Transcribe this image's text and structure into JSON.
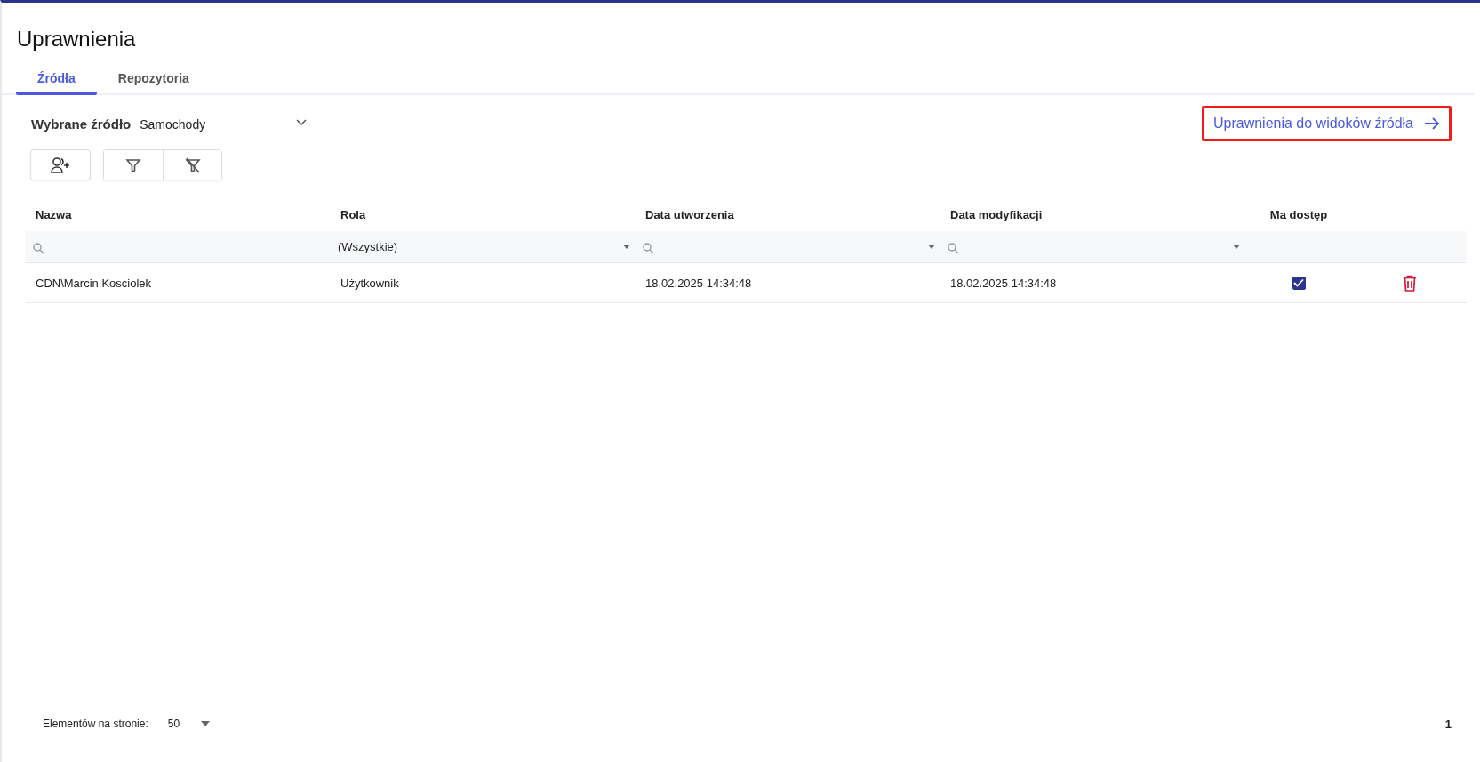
{
  "page": {
    "title": "Uprawnienia"
  },
  "tabs": [
    {
      "label": "Źródła",
      "selected": true
    },
    {
      "label": "Repozytoria",
      "selected": false
    }
  ],
  "source": {
    "label": "Wybrane źródło",
    "value": "Samochody"
  },
  "views_link": {
    "label": "Uprawnienia do widoków źródła",
    "highlighted": true
  },
  "table": {
    "columns": [
      {
        "label": "Nazwa",
        "kind": "search"
      },
      {
        "label": "Rola",
        "kind": "select",
        "value": "(Wszystkie)"
      },
      {
        "label": "Data utworzenia",
        "kind": "searchselect"
      },
      {
        "label": "Data modyfikacji",
        "kind": "searchselect"
      },
      {
        "label": "Ma dostęp",
        "kind": "none"
      }
    ],
    "rows": [
      {
        "name": "CDN\\Marcin.Kosciolek",
        "role": "Użytkownik",
        "created": "18.02.2025 14:34:48",
        "modified": "18.02.2025 14:34:48",
        "has_access": true
      }
    ]
  },
  "footer": {
    "page_size_label": "Elementów na stronie:",
    "page_size": "50",
    "page": "1"
  }
}
